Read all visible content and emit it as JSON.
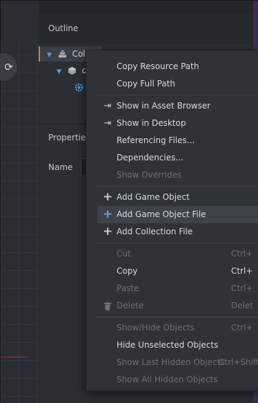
{
  "outline": {
    "title": "Outline",
    "tree": {
      "collection_label": "Coll",
      "game_object_label": "de"
    }
  },
  "properties": {
    "title": "Properties",
    "name_label": "Name"
  },
  "context_menu": {
    "copy_resource_path": "Copy Resource Path",
    "copy_full_path": "Copy Full Path",
    "show_in_asset_browser": "Show in Asset Browser",
    "show_in_desktop": "Show in Desktop",
    "referencing_files": "Referencing Files...",
    "dependencies": "Dependencies...",
    "show_overrides": "Show Overrides",
    "add_game_object": "Add Game Object",
    "add_game_object_file": "Add Game Object File",
    "add_collection_file": "Add Collection File",
    "cut": "Cut",
    "cut_shortcut": "Ctrl+",
    "copy": "Copy",
    "copy_shortcut": "Ctrl+",
    "paste": "Paste",
    "paste_shortcut": "Ctrl+",
    "delete": "Delete",
    "delete_shortcut": "Delet",
    "show_hide_objects": "Show/Hide Objects",
    "show_hide_shortcut": "Ctrl+",
    "hide_unselected_objects": "Hide Unselected Objects",
    "show_last_hidden_objects": "Show Last Hidden Objects",
    "show_last_hidden_shortcut": "Ctrl+Shift+",
    "show_all_hidden_objects": "Show All Hidden Objects"
  },
  "icons": {
    "viewport_tool": "rotate-icon",
    "collection": "collection-icon",
    "game_object": "game-object-icon",
    "component": "gear-icon",
    "show_in": "jump-to-icon",
    "add": "plus-icon",
    "delete": "trash-icon"
  },
  "colors": {
    "selection_accent": "#e07a3a",
    "tree_arrow": "#4aa3e8",
    "highlight_plus": "#58a6e8"
  }
}
